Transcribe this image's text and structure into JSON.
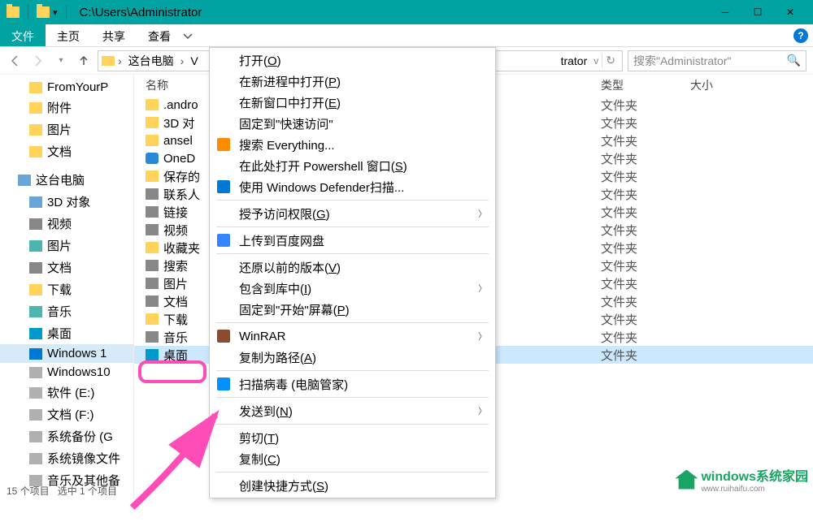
{
  "titlebar": {
    "path": "C:\\Users\\Administrator"
  },
  "ribbon": {
    "file": "文件",
    "home": "主页",
    "share": "共享",
    "view": "查看"
  },
  "breadcrumb": {
    "pc": "这台电脑",
    "trail": "trator"
  },
  "search": {
    "placeholder": "搜索\"Administrator\""
  },
  "sidebar": {
    "items": [
      {
        "label": "FromYourP",
        "ico": "ico"
      },
      {
        "label": "附件",
        "ico": "ico"
      },
      {
        "label": "图片",
        "ico": "ico"
      },
      {
        "label": "文档",
        "ico": "ico"
      }
    ],
    "pc_label": "这台电脑",
    "pc_items": [
      {
        "label": "3D 对象",
        "ico": "pc"
      },
      {
        "label": "视频",
        "ico": "vid"
      },
      {
        "label": "图片",
        "ico": "img"
      },
      {
        "label": "文档",
        "ico": "doc"
      },
      {
        "label": "下载",
        "ico": "ico"
      },
      {
        "label": "音乐",
        "ico": "music"
      },
      {
        "label": "桌面",
        "ico": "desk"
      },
      {
        "label": "Windows 1",
        "ico": "win",
        "active": true
      },
      {
        "label": "Windows10",
        "ico": "drive"
      },
      {
        "label": "软件 (E:)",
        "ico": "drive"
      },
      {
        "label": "文档 (F:)",
        "ico": "drive"
      },
      {
        "label": "系统备份 (G",
        "ico": "drive"
      },
      {
        "label": "系统镜像文件",
        "ico": "drive"
      },
      {
        "label": "音乐及其他备",
        "ico": "drive"
      }
    ]
  },
  "columns": {
    "name": "名称",
    "type": "类型",
    "size": "大小"
  },
  "files": [
    {
      "name": ".andro",
      "ico": "ico",
      "type": "文件夹"
    },
    {
      "name": "3D 对",
      "ico": "ico",
      "type": "文件夹"
    },
    {
      "name": "ansel",
      "ico": "ico",
      "type": "文件夹"
    },
    {
      "name": "OneD",
      "ico": "onedrive",
      "type": "文件夹"
    },
    {
      "name": "保存的",
      "ico": "ico",
      "type": "文件夹"
    },
    {
      "name": "联系人",
      "ico": "sp",
      "type": "文件夹"
    },
    {
      "name": "链接",
      "ico": "link",
      "type": "文件夹"
    },
    {
      "name": "视频",
      "ico": "sp",
      "type": "文件夹"
    },
    {
      "name": "收藏夹",
      "ico": "ico",
      "type": "文件夹"
    },
    {
      "name": "搜索",
      "ico": "sp",
      "type": "文件夹"
    },
    {
      "name": "图片",
      "ico": "sp",
      "type": "文件夹"
    },
    {
      "name": "文档",
      "ico": "sp",
      "type": "文件夹"
    },
    {
      "name": "下载",
      "ico": "ico",
      "type": "文件夹"
    },
    {
      "name": "音乐",
      "ico": "sp",
      "type": "文件夹"
    },
    {
      "name": "桌面",
      "ico": "desk",
      "type": "文件夹",
      "selected": true
    }
  ],
  "ctx": [
    {
      "label": "打开(",
      "acc": "O",
      "tail": ")"
    },
    {
      "label": "在新进程中打开(",
      "acc": "P",
      "tail": ")"
    },
    {
      "label": "在新窗口中打开(",
      "acc": "E",
      "tail": ")"
    },
    {
      "label": "固定到\"快速访问\""
    },
    {
      "label": "搜索 Everything...",
      "icon": "search",
      "color": "#ff8c00"
    },
    {
      "label": "在此处打开 Powershell 窗口(",
      "acc": "S",
      "tail": ")"
    },
    {
      "label": "使用 Windows Defender扫描...",
      "icon": "defender",
      "color": "#0078d4"
    },
    {
      "sep": true
    },
    {
      "label": "授予访问权限(",
      "acc": "G",
      "tail": ")",
      "arrow": true
    },
    {
      "sep": true
    },
    {
      "label": "上传到百度网盘",
      "icon": "baidu",
      "color": "#3385ff"
    },
    {
      "sep": true
    },
    {
      "label": "还原以前的版本(",
      "acc": "V",
      "tail": ")"
    },
    {
      "label": "包含到库中(",
      "acc": "I",
      "tail": ")",
      "arrow": true
    },
    {
      "label": "固定到\"开始\"屏幕(",
      "acc": "P",
      "tail": ")"
    },
    {
      "sep": true
    },
    {
      "label": "WinRAR",
      "icon": "winrar",
      "color": "#8a4b2e",
      "arrow": true
    },
    {
      "label": "复制为路径(",
      "acc": "A",
      "tail": ")"
    },
    {
      "sep": true
    },
    {
      "label": "扫描病毒 (电脑管家)",
      "icon": "qq",
      "color": "#0091ff"
    },
    {
      "sep": true
    },
    {
      "label": "发送到(",
      "acc": "N",
      "tail": ")",
      "arrow": true
    },
    {
      "sep": true
    },
    {
      "label": "剪切(",
      "acc": "T",
      "tail": ")"
    },
    {
      "label": "复制(",
      "acc": "C",
      "tail": ")"
    },
    {
      "sep": true
    },
    {
      "label": "创建快捷方式(",
      "acc": "S",
      "tail": ")"
    }
  ],
  "status": {
    "count": "15 个项目",
    "selected": "选中 1 个项目"
  },
  "watermark": {
    "brand": "windows系统家园",
    "url": "www.ruihaifu.com"
  }
}
